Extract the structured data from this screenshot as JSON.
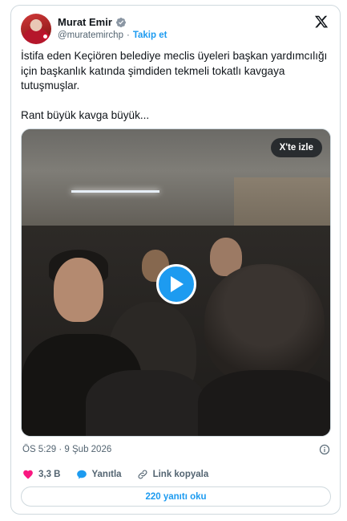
{
  "author": {
    "display_name": "Murat Emir",
    "handle": "@muratemirchp",
    "separator": "·",
    "follow_label": "Takip et"
  },
  "tweet": {
    "paragraphs": [
      "İstifa eden Keçiören belediye meclis üyeleri başkan yardımcılığı için başkanlık katında şimdiden tekmeli tokatlı kavgaya tutuşmuşlar.",
      "Rant büyük kavga büyük..."
    ]
  },
  "media": {
    "watch_on_x_label": "X'te izle"
  },
  "meta": {
    "timestamp": "ÖS 5:29 · 9 Şub 2026"
  },
  "actions": {
    "like_count": "3,3 B",
    "reply_label": "Yanıtla",
    "copy_link_label": "Link kopyala"
  },
  "footer": {
    "read_replies_label": "220 yanıtı oku"
  },
  "colors": {
    "accent": "#1d9bf0",
    "like": "#f91880",
    "text": "#0f1419",
    "secondary": "#536471",
    "border": "#cfd9de"
  }
}
